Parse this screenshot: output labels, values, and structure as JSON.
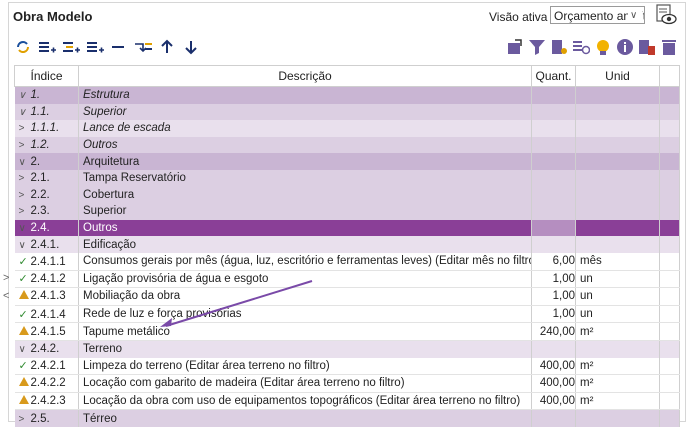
{
  "header": {
    "title": "Obra Modelo",
    "view_label": "Visão ativa",
    "view_value": "Orçamento analític"
  },
  "colors": {
    "accent": "#8a3f97",
    "level1": "#c9b5d3",
    "level2": "#dccfe2",
    "level3": "#e9e0ed",
    "arrow": "#7a4aa8"
  },
  "toolbar": {
    "left": [
      "refresh-icon",
      "add-item-icon",
      "add-subitem-icon",
      "add-group-icon",
      "remove-icon",
      "indent-icon",
      "move-up-icon",
      "move-down-icon"
    ],
    "right": [
      "export-icon",
      "filter-icon",
      "list-settings-icon",
      "duplicate-icon",
      "lightbulb-icon",
      "info-icon",
      "trash-list-icon",
      "delete-icon"
    ]
  },
  "table": {
    "columns": {
      "index": "Índice",
      "desc": "Descrição",
      "qty": "Quant.",
      "unit": "Unid"
    },
    "rows": [
      {
        "icon": "chevron-down",
        "index": "1.",
        "desc": "Estrutura",
        "qty": "",
        "unit": "",
        "style": "lvl1 ital"
      },
      {
        "icon": "chevron-down",
        "index": "1.1.",
        "desc": "Superior",
        "qty": "",
        "unit": "",
        "style": "lvl2 ital"
      },
      {
        "icon": "chevron-right",
        "index": "1.1.1.",
        "desc": "Lance de escada",
        "qty": "",
        "unit": "",
        "style": "lvl3 ital"
      },
      {
        "icon": "chevron-right",
        "index": "1.2.",
        "desc": "Outros",
        "qty": "",
        "unit": "",
        "style": "lvl2 ital"
      },
      {
        "icon": "chevron-down",
        "index": "2.",
        "desc": "Arquitetura",
        "qty": "",
        "unit": "",
        "style": "lvl1"
      },
      {
        "icon": "chevron-right",
        "index": "2.1.",
        "desc": "Tampa Reservatório",
        "qty": "",
        "unit": "",
        "style": "lvl2"
      },
      {
        "icon": "chevron-right",
        "index": "2.2.",
        "desc": "Cobertura",
        "qty": "",
        "unit": "",
        "style": "lvl2"
      },
      {
        "icon": "chevron-right",
        "index": "2.3.",
        "desc": "Superior",
        "qty": "",
        "unit": "",
        "style": "lvl2"
      },
      {
        "icon": "chevron-down",
        "index": "2.4.",
        "desc": "Outros",
        "qty": "",
        "unit": "",
        "style": "lvlsel"
      },
      {
        "icon": "chevron-down",
        "index": "2.4.1.",
        "desc": "Edificação",
        "qty": "",
        "unit": "",
        "style": "lvl3"
      },
      {
        "icon": "check",
        "index": "2.4.1.1",
        "desc": "Consumos gerais por mês (água, luz, escritório e ferramentas leves) (Editar mês no filtro)",
        "qty": "6,00",
        "unit": "mês",
        "style": "leaf"
      },
      {
        "icon": "check",
        "index": "2.4.1.2",
        "desc": "Ligação provisória de água e esgoto",
        "qty": "1,00",
        "unit": "un",
        "style": "leaf"
      },
      {
        "icon": "warning",
        "index": "2.4.1.3",
        "desc": "Mobiliação da obra",
        "qty": "1,00",
        "unit": "un",
        "style": "leaf"
      },
      {
        "icon": "check",
        "index": "2.4.1.4",
        "desc": "Rede de luz e força provisórias",
        "qty": "1,00",
        "unit": "un",
        "style": "leaf"
      },
      {
        "icon": "warning",
        "index": "2.4.1.5",
        "desc": "Tapume metálico",
        "qty": "240,00",
        "unit": "m²",
        "style": "leaf"
      },
      {
        "icon": "chevron-down",
        "index": "2.4.2.",
        "desc": "Terreno",
        "qty": "",
        "unit": "",
        "style": "lvl3"
      },
      {
        "icon": "check",
        "index": "2.4.2.1",
        "desc": "Limpeza do terreno (Editar área terreno no filtro)",
        "qty": "400,00",
        "unit": "m²",
        "style": "leaf"
      },
      {
        "icon": "warning",
        "index": "2.4.2.2",
        "desc": "Locação com gabarito de madeira (Editar área terreno no filtro)",
        "qty": "400,00",
        "unit": "m²",
        "style": "leaf"
      },
      {
        "icon": "warning",
        "index": "2.4.2.3",
        "desc": "Locação da obra com uso de equipamentos topográficos (Editar área terreno no filtro)",
        "qty": "400,00",
        "unit": "m²",
        "style": "leaf"
      },
      {
        "icon": "chevron-right",
        "index": "2.5.",
        "desc": "Térreo",
        "qty": "",
        "unit": "",
        "style": "lvl2"
      }
    ]
  }
}
